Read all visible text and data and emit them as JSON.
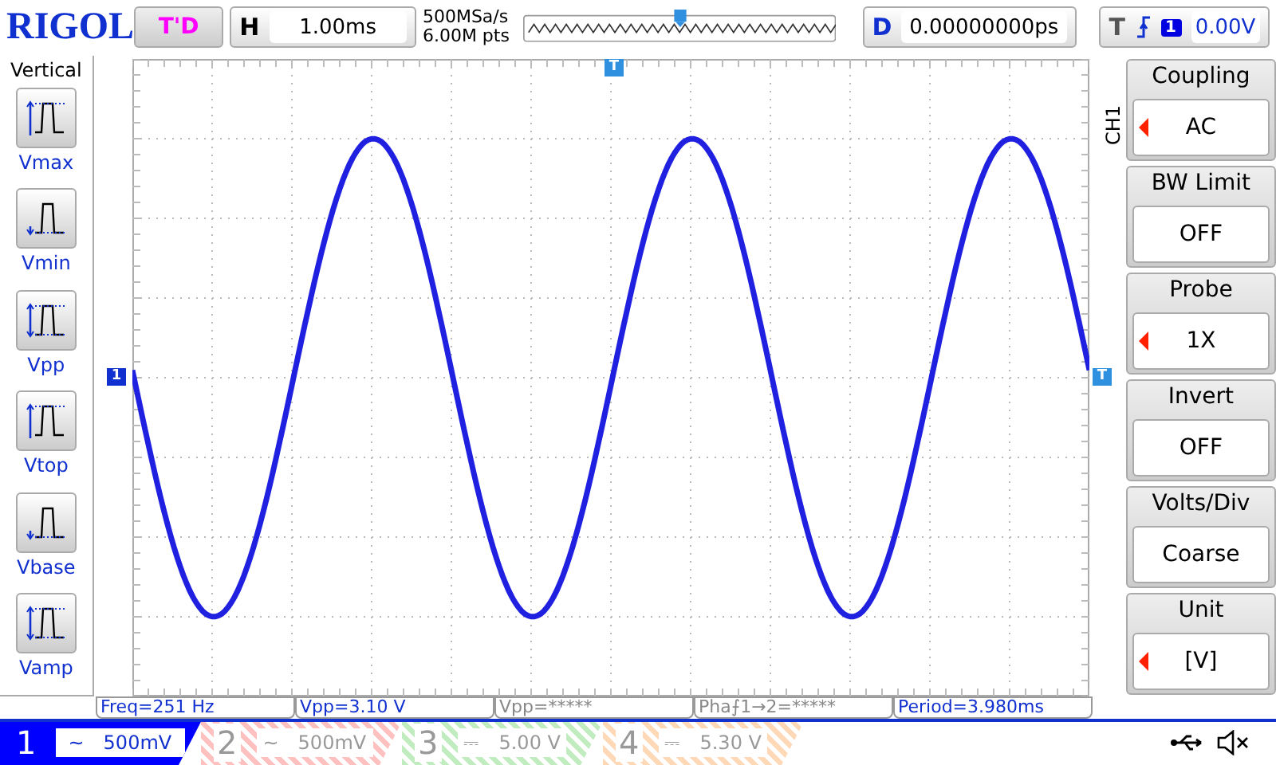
{
  "header": {
    "logo": "RIGOL",
    "run_state": "T'D",
    "timebase": {
      "label": "H",
      "value": "1.00ms"
    },
    "sample_rate": "500MSa/s",
    "memory_depth": "6.00M pts",
    "delay": {
      "label": "D",
      "value": "0.00000000ps"
    },
    "trigger": {
      "label": "T",
      "source": "1",
      "level": "0.00V"
    }
  },
  "measure_panel": {
    "title": "Vertical",
    "items": [
      {
        "label": "Vmax",
        "kind": "vmax"
      },
      {
        "label": "Vmin",
        "kind": "vmin"
      },
      {
        "label": "Vpp",
        "kind": "vpp"
      },
      {
        "label": "Vtop",
        "kind": "vtop"
      },
      {
        "label": "Vbase",
        "kind": "vbase"
      },
      {
        "label": "Vamp",
        "kind": "vamp"
      }
    ]
  },
  "plot": {
    "channel_marker": "1",
    "trigger_marker": "T",
    "level_marker": "T"
  },
  "menu": {
    "channel": "CH1",
    "items": [
      {
        "label": "Coupling",
        "value": "AC",
        "arrow": true
      },
      {
        "label": "BW Limit",
        "value": "OFF",
        "arrow": false
      },
      {
        "label": "Probe",
        "value": "1X",
        "arrow": true
      },
      {
        "label": "Invert",
        "value": "OFF",
        "arrow": false
      },
      {
        "label": "Volts/Div",
        "value": "Coarse",
        "arrow": false
      },
      {
        "label": "Unit",
        "value": "[V]",
        "arrow": true
      }
    ]
  },
  "measurements": [
    {
      "text": "Freq=251 Hz",
      "active": true
    },
    {
      "text": "Vpp=3.10 V",
      "active": true
    },
    {
      "text": "Vpp=*****",
      "active": false
    },
    {
      "text": "Pha⨍1→2=*****",
      "active": false
    },
    {
      "text": "Period=3.980ms",
      "active": true
    }
  ],
  "channels": [
    {
      "number": "1",
      "coupling": "~",
      "scale": "500mV",
      "selected": true,
      "color": "#0000ff"
    },
    {
      "number": "2",
      "coupling": "~",
      "scale": "500mV",
      "selected": false,
      "color": "#ffc0c0"
    },
    {
      "number": "3",
      "coupling": "⎓",
      "scale": "5.00 V",
      "selected": false,
      "color": "#c0ecc0"
    },
    {
      "number": "4",
      "coupling": "⎓",
      "scale": "5.30 V",
      "selected": false,
      "color": "#ffd8b8"
    }
  ]
}
